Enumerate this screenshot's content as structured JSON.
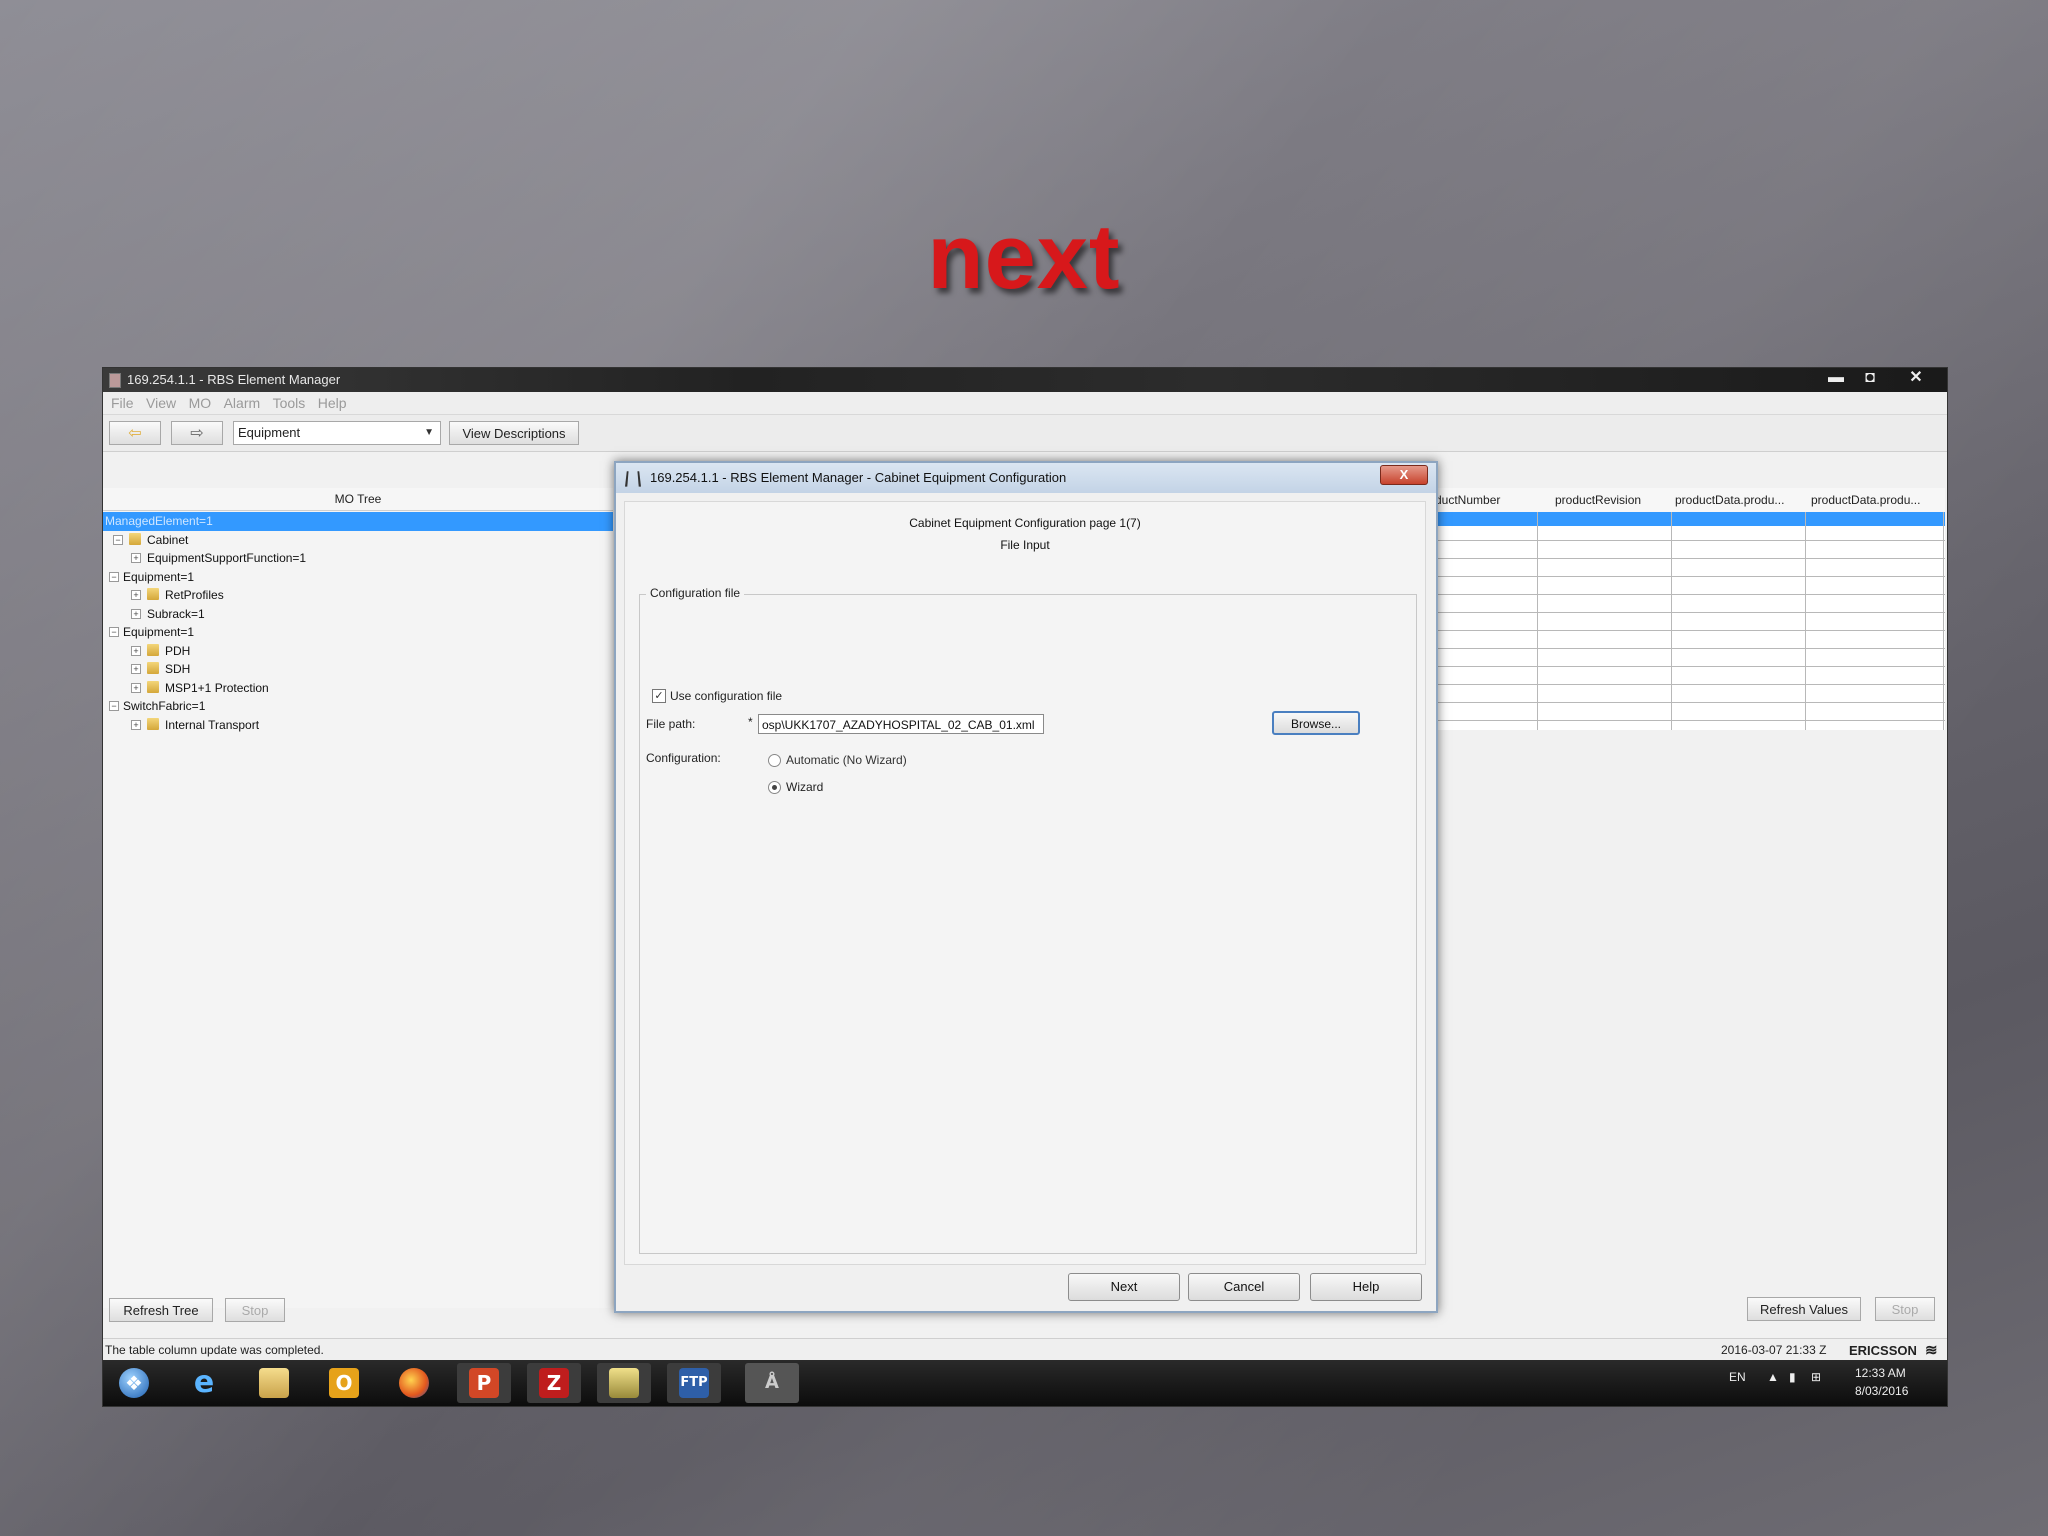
{
  "slide": {
    "title": "next"
  },
  "window": {
    "title": "169.254.1.1 - RBS Element Manager",
    "controls": {
      "minimize": "▬",
      "restore": "◘",
      "close": "✕"
    }
  },
  "menu": [
    "File",
    "View",
    "MO",
    "Alarm",
    "Tools",
    "Help"
  ],
  "toolbar": {
    "back_icon": "back-arrow-icon",
    "forward_icon": "forward-arrow-icon",
    "combo_value": "Equipment",
    "view_descriptions": "View Descriptions"
  },
  "mo_tree": {
    "header": "MO Tree",
    "items": [
      {
        "label": "ManagedElement=1",
        "selected": true
      },
      {
        "label": "Cabinet"
      },
      {
        "label": "EquipmentSupportFunction=1"
      },
      {
        "label": "Equipment=1"
      },
      {
        "label": "RetProfiles"
      },
      {
        "label": "Subrack=1"
      },
      {
        "label": "Equipment=1"
      },
      {
        "label": "PDH"
      },
      {
        "label": "SDH"
      },
      {
        "label": "MSP1+1 Protection"
      },
      {
        "label": "SwitchFabric=1"
      },
      {
        "label": "Internal Transport"
      }
    ],
    "refresh_tree": "Refresh Tree",
    "stop": "Stop"
  },
  "table": {
    "columns": [
      "ductNumber",
      "productRevision",
      "productData.produ...",
      "productData.produ..."
    ],
    "refresh_values": "Refresh Values",
    "stop": "Stop"
  },
  "status": {
    "message": "The table column update was completed.",
    "timestamp": "2016-03-07 21:33 Z",
    "brand": "ERICSSON"
  },
  "dialog": {
    "title": "169.254.1.1 - RBS Element Manager - Cabinet Equipment Configuration",
    "close": "X",
    "page_title": "Cabinet Equipment Configuration page 1(7)",
    "page_subtitle": "File Input",
    "group_label": "Configuration file",
    "use_config_file": "Use configuration file",
    "use_config_checked": "✓",
    "file_path_label": "File path:",
    "required_mark": "*",
    "file_path_value": "osp\\UKK1707_AZADYHOSPITAL_02_CAB_01.xml",
    "browse": "Browse...",
    "configuration_label": "Configuration:",
    "option_automatic": "Automatic (No Wizard)",
    "option_wizard": "Wizard",
    "selected_option": "Wizard",
    "next": "Next",
    "cancel": "Cancel",
    "help": "Help"
  },
  "taskbar": {
    "apps": [
      "start-orb-icon",
      "internet-explorer-icon",
      "file-explorer-icon",
      "outlook-icon",
      "firefox-icon",
      "powerpoint-icon",
      "filezilla-icon",
      "element-manager-icon",
      "ftp-icon",
      "rbs-manager-icon"
    ],
    "language": "EN",
    "time": "12:33 AM",
    "date": "8/03/2016"
  }
}
